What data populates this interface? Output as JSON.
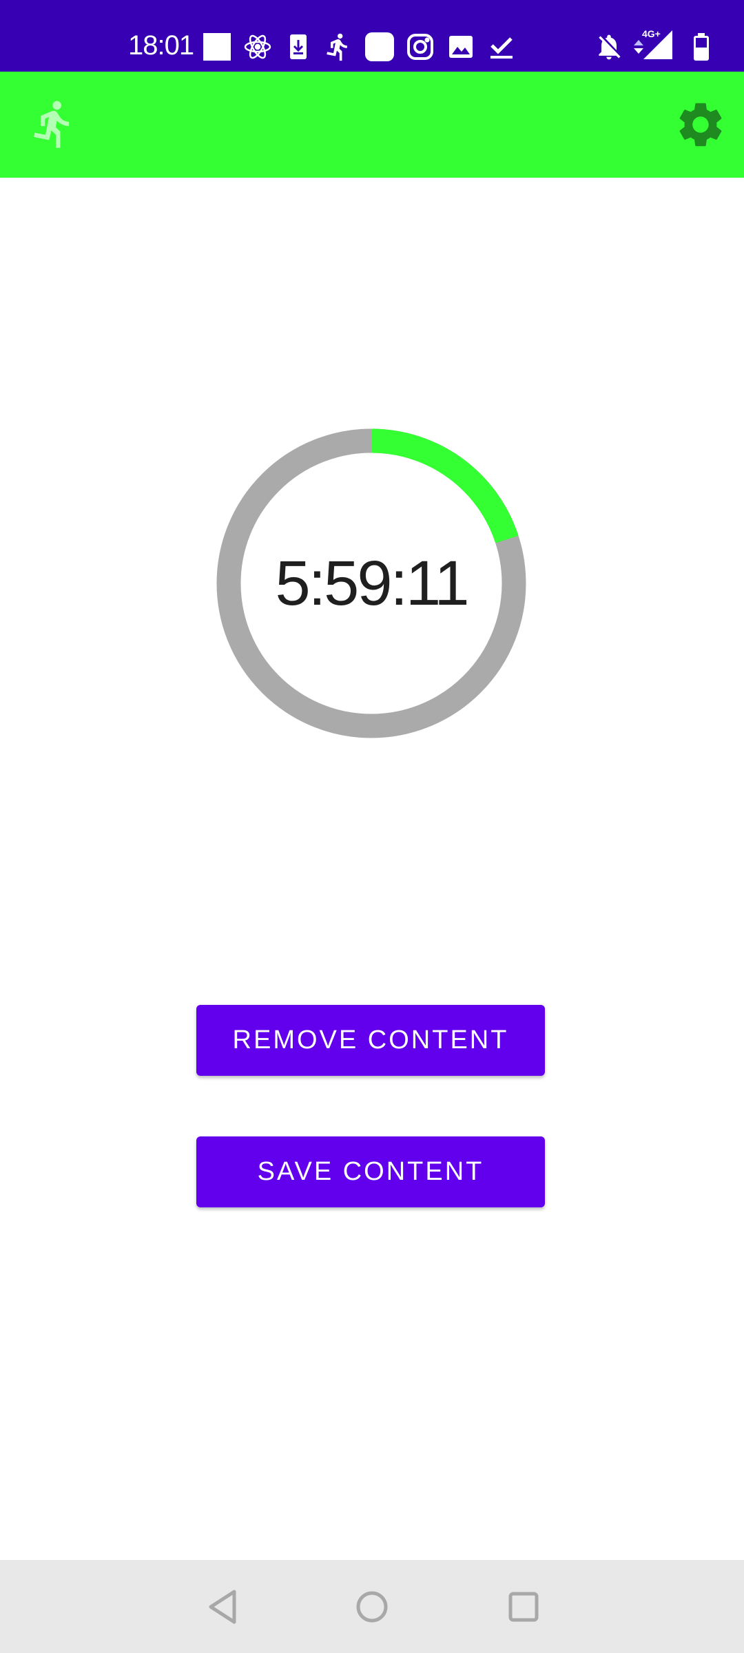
{
  "status_bar": {
    "time": "18:01",
    "background": "#3700b3",
    "notification_icons": [
      "white-square-icon",
      "atom-icon",
      "download-icon",
      "running-figure-icon",
      "rounded-square-icon",
      "instagram-icon",
      "image-icon",
      "checkmark-icon"
    ],
    "system_icons": [
      "bell-off-icon",
      "data-arrows-icon",
      "signal-4g-icon",
      "battery-icon"
    ],
    "network_label": "4G+"
  },
  "app_bar": {
    "background": "#33ff33",
    "left_icon": "running-figure-icon",
    "right_icon": "gear-icon"
  },
  "timer": {
    "display": "5:59:11",
    "progress_fraction": 0.2,
    "progress_color": "#33ff33",
    "track_color": "#aaaaaa"
  },
  "actions": {
    "remove_label": "REMOVE CONTENT",
    "save_label": "SAVE CONTENT",
    "button_color": "#6200ee"
  },
  "nav_bar": {
    "icons": [
      "back-icon",
      "home-icon",
      "recents-icon"
    ]
  }
}
